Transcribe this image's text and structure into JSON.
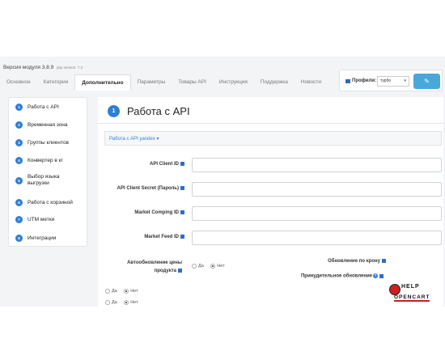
{
  "header": {
    "version": "Версия модуля 3.8.9",
    "php_version": "php version: 7.3"
  },
  "tabs": [
    {
      "label": "Основное"
    },
    {
      "label": "Категории"
    },
    {
      "label": "Дополнительно",
      "active": true
    },
    {
      "label": "Параметры"
    },
    {
      "label": "Товары API"
    },
    {
      "label": "Инструкция"
    },
    {
      "label": "Поддержка"
    },
    {
      "label": "Новости"
    }
  ],
  "profile": {
    "label": "Профили:",
    "selected": "турбо",
    "save_icon": "pencil-icon"
  },
  "sidebar": {
    "items": [
      {
        "num": "1",
        "label": "Работа с API"
      },
      {
        "num": "2",
        "label": "Временная зона"
      },
      {
        "num": "3",
        "label": "Группы клиентов"
      },
      {
        "num": "4",
        "label": "Конвертер в кг"
      },
      {
        "num": "5",
        "label": "Выбор языка выгрузки"
      },
      {
        "num": "6",
        "label": "Работа с корзиной"
      },
      {
        "num": "7",
        "label": "UTM метки"
      },
      {
        "num": "8",
        "label": "Интеграции"
      }
    ]
  },
  "content": {
    "num": "1",
    "title": "Работа с API",
    "api_dropdown": "Работа с API yandex",
    "fields": [
      {
        "label": "API Client ID",
        "value": ""
      },
      {
        "label": "API Client Secret (Пароль)",
        "value": ""
      },
      {
        "label": "Market Comping ID",
        "value": ""
      },
      {
        "label": "Market Feed ID",
        "value": ""
      }
    ],
    "auto_update": {
      "label_line1": "Автообновление цены",
      "label_line2": "продукта",
      "yes": "Да",
      "no": "Нет",
      "selected": "no"
    },
    "cron_update": {
      "label": "Обновление по крону"
    },
    "forced_update": {
      "label": "Принудительное обновление"
    },
    "extra_radios": [
      {
        "yes": "Да",
        "no": "Нет",
        "selected": "no"
      },
      {
        "yes": "Да",
        "no": "Нет",
        "selected": "no"
      }
    ]
  },
  "logo": {
    "line1": "HELP",
    "line2": "OPENCART"
  },
  "colors": {
    "accent": "#2f7fd7",
    "button": "#49a7dc",
    "panel_bg": "#f3f4f6"
  }
}
